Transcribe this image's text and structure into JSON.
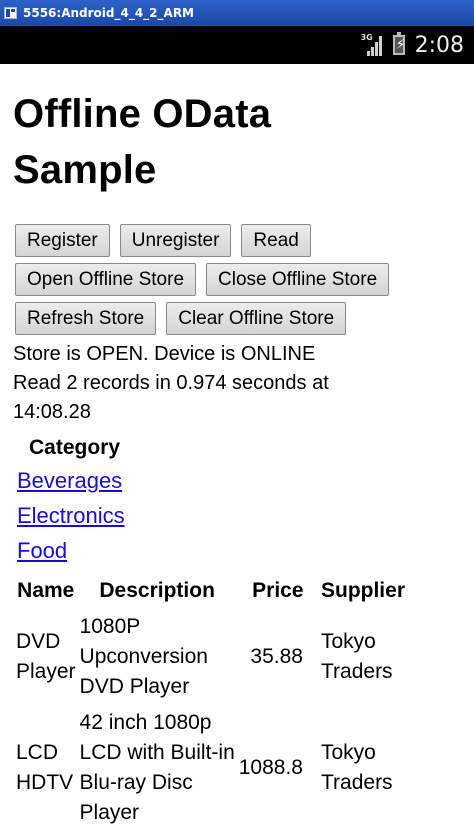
{
  "window": {
    "title": "5556:Android_4_4_2_ARM"
  },
  "statusbar": {
    "network": "3G",
    "time": "2:08",
    "icons": [
      "signal-icon",
      "battery-charging-icon"
    ]
  },
  "app": {
    "title_line1": "Offline OData",
    "title_line2": "Sample"
  },
  "buttons": {
    "register": "Register",
    "unregister": "Unregister",
    "read": "Read",
    "open_store": "Open Offline Store",
    "close_store": "Close Offline Store",
    "refresh_store": "Refresh Store",
    "clear_store": "Clear Offline Store"
  },
  "status": {
    "line1": "Store is OPEN. Device is ONLINE",
    "line2": "Read 2 records in 0.974 seconds at",
    "line3": "14:08.28"
  },
  "categories": {
    "header": "Category",
    "items": [
      "Beverages",
      "Electronics",
      "Food"
    ]
  },
  "products": {
    "columns": [
      "Name",
      "Description",
      "Price",
      "Supplier"
    ],
    "rows": [
      {
        "name": [
          "DVD",
          "Player"
        ],
        "description": [
          "1080P",
          "Upconversion",
          "DVD Player"
        ],
        "price": "35.88",
        "supplier": [
          "Tokyo",
          "Traders"
        ]
      },
      {
        "name": [
          "LCD",
          "HDTV"
        ],
        "description": [
          "42 inch 1080p",
          "LCD with Built-in",
          "Blu-ray Disc",
          "Player"
        ],
        "price": "1088.8",
        "supplier": [
          "Tokyo",
          "Traders"
        ]
      }
    ]
  },
  "colors": {
    "link": "#1a0dcc",
    "titlebar": "#1c48a6",
    "statusbar": "#000000"
  }
}
